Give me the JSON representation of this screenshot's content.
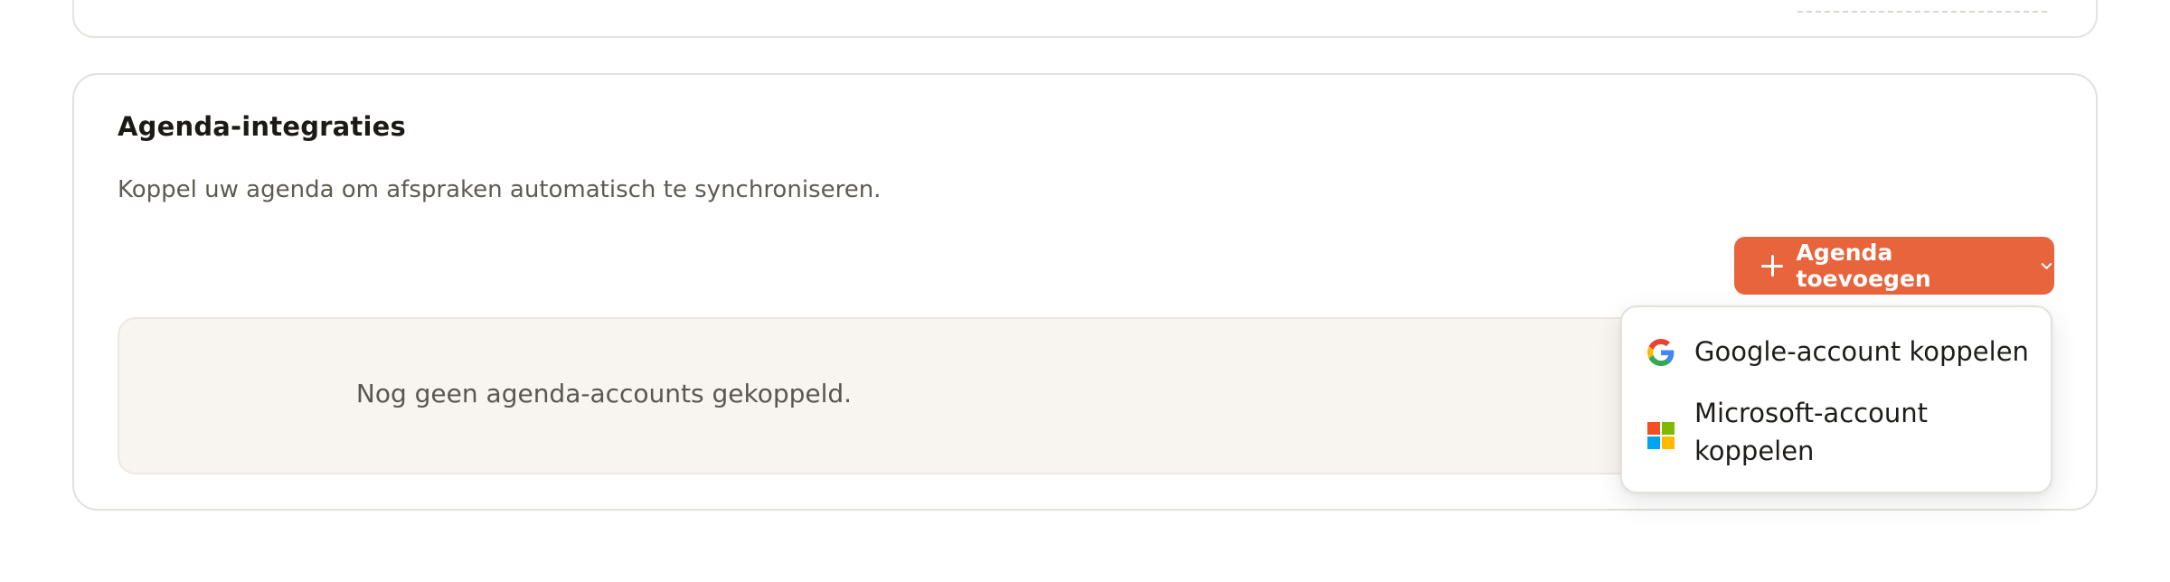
{
  "section": {
    "title": "Agenda-integraties",
    "description": "Koppel uw agenda om afspraken automatisch te synchroniseren.",
    "empty_state": "Nog geen agenda-accounts gekoppeld."
  },
  "add_button": {
    "label": "Agenda toevoegen",
    "icon": "plus-icon",
    "caret_icon": "chevron-down-icon",
    "color": "#e7643c"
  },
  "dropdown": {
    "items": [
      {
        "label": "Google-account koppelen",
        "icon": "google-icon"
      },
      {
        "label": "Microsoft-account koppelen",
        "icon": "microsoft-icon"
      }
    ]
  },
  "colors": {
    "accent": "#e7643c",
    "empty_bg": "#f8f5f0",
    "border": "#e2e0dc"
  }
}
